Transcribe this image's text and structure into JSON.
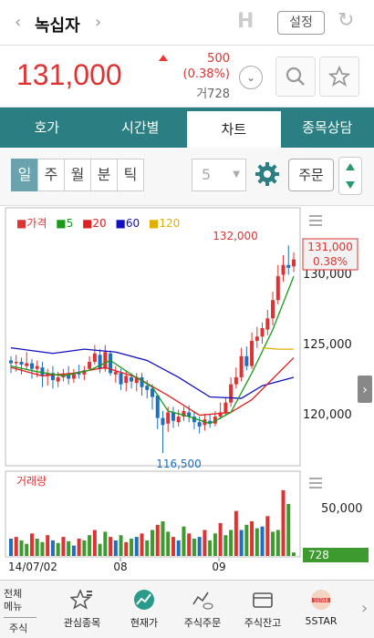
{
  "header": {
    "title": "녹십자",
    "h_label": "H",
    "settings_label": "설정"
  },
  "quote": {
    "price": "131,000",
    "change": "500",
    "change_pct": "(0.38%)",
    "volume": "거728"
  },
  "tabs": [
    "호가",
    "시간별",
    "차트",
    "종목상담"
  ],
  "period": {
    "buttons": [
      "일",
      "주",
      "월",
      "분",
      "틱"
    ],
    "selected": "일",
    "count_value": "5",
    "order_label": "주문"
  },
  "chart_data": {
    "type": "candlestick",
    "legend": [
      {
        "label": "가격",
        "color": "#d33"
      },
      {
        "label": "5",
        "color": "#1a9a1a"
      },
      {
        "label": "20",
        "color": "#e02020"
      },
      {
        "label": "60",
        "color": "#1010c0"
      },
      {
        "label": "120",
        "color": "#e0b000"
      }
    ],
    "price_axis_labels": [
      "130,000",
      "125,000",
      "120,000"
    ],
    "high_label": "132,000",
    "low_label": "116,500",
    "current_price_tag": {
      "price": "131,000",
      "pct": "0.38%"
    },
    "volume_title": "거래량",
    "volume_axis_label": "50,000",
    "volume_tag": "728",
    "x_labels": [
      "14/07/02",
      "08",
      "09"
    ]
  },
  "bottom_nav": {
    "menu_label": "전체\n메뉴",
    "sub_label": "주식",
    "items": [
      {
        "label": "관심종목",
        "icon": "star-list-icon"
      },
      {
        "label": "현재가",
        "icon": "chart-up-icon"
      },
      {
        "label": "주식주문",
        "icon": "order-icon"
      },
      {
        "label": "주식잔고",
        "icon": "wallet-icon"
      },
      {
        "label": "5STAR",
        "icon": "5star-icon"
      }
    ]
  }
}
